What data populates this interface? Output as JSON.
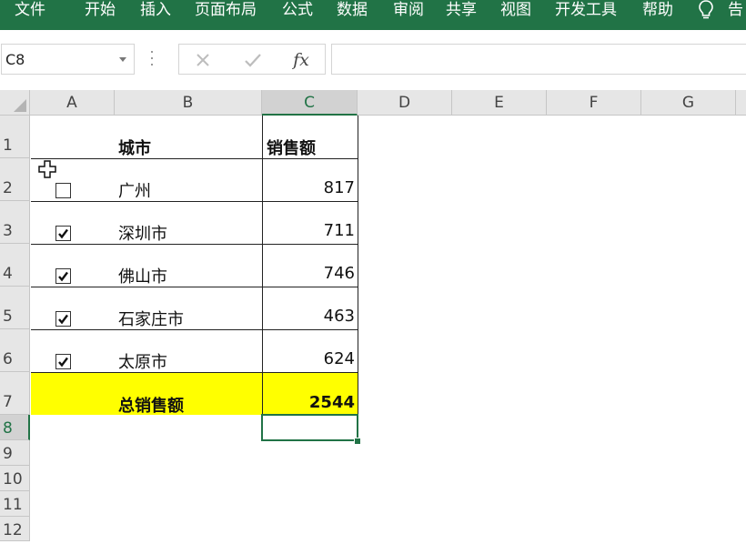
{
  "ribbon": {
    "tabs": [
      "文件",
      "开始",
      "插入",
      "页面布局",
      "公式",
      "数据",
      "审阅",
      "共享",
      "视图",
      "开发工具",
      "帮助"
    ],
    "tell_me": "告"
  },
  "formula_bar": {
    "name_box": "C8",
    "fx_label": "fx",
    "formula": ""
  },
  "columns": [
    "A",
    "B",
    "C",
    "D",
    "E",
    "F",
    "G"
  ],
  "rows": [
    "1",
    "2",
    "3",
    "4",
    "5",
    "6",
    "7",
    "8",
    "9",
    "10",
    "11",
    "12"
  ],
  "selected_cell": "C8",
  "table": {
    "header_city": "城市",
    "header_sales": "销售额",
    "items": [
      {
        "city": "广州",
        "sales": "817",
        "checked": false
      },
      {
        "city": "深圳市",
        "sales": "711",
        "checked": true
      },
      {
        "city": "佛山市",
        "sales": "746",
        "checked": true
      },
      {
        "city": "石家庄市",
        "sales": "463",
        "checked": true
      },
      {
        "city": "太原市",
        "sales": "624",
        "checked": true
      }
    ],
    "total_label": "总销售额",
    "total_value": "2544"
  },
  "colors": {
    "ribbon": "#217346",
    "highlight": "#ffff00",
    "selection": "#217346"
  }
}
